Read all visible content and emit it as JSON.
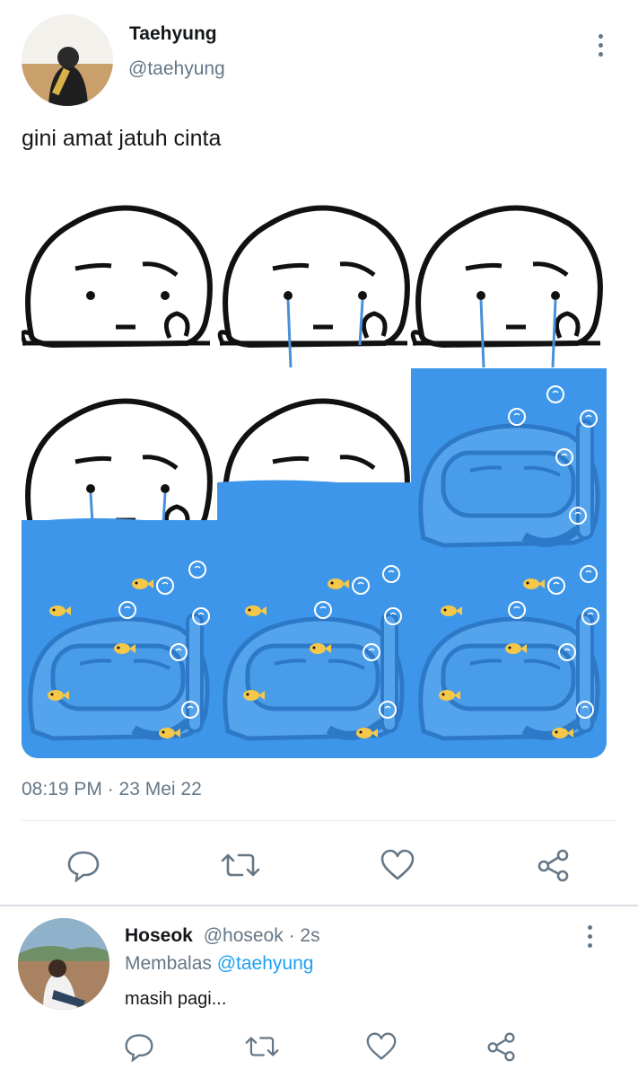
{
  "tweet": {
    "author_name": "Taehyung",
    "author_handle": "@taehyung",
    "text": "gini amat jatuh cinta",
    "timestamp": "08:19 PM · 23 Mei 22",
    "media_icon": "meme-grid-image"
  },
  "actions": [
    "reply-icon",
    "retweet-icon",
    "like-icon",
    "share-icon"
  ],
  "reply": {
    "author_name": "Hoseok",
    "author_handle": "@hoseok",
    "time": "· 2s",
    "replying_prefix": "Membalas",
    "replying_to": "@taehyung",
    "text": "masih pagi..."
  },
  "colors": {
    "text": "#14171a",
    "secondary": "#657786",
    "link": "#1da1f2",
    "water": "#3d96ea",
    "divider": "#e1e8ed"
  }
}
